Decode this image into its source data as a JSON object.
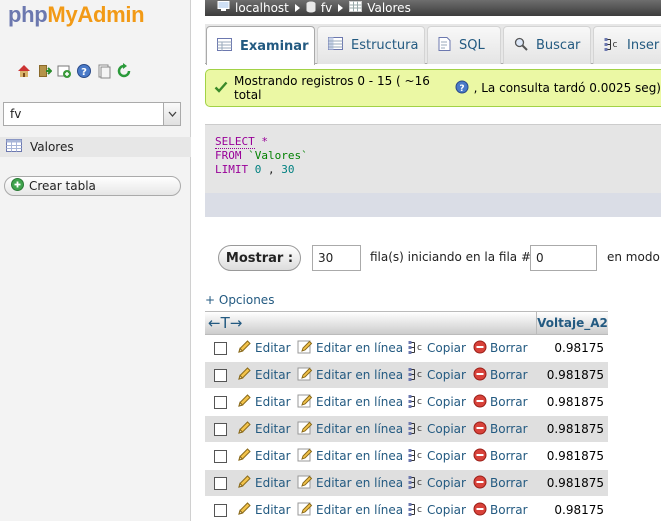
{
  "app": {
    "logo_php": "php",
    "logo_myadmin": "MyAdmin"
  },
  "sidebar": {
    "icons": [
      "home-icon",
      "exit-icon",
      "sql-window-icon",
      "help-icon",
      "documentation-icon",
      "reload-icon"
    ],
    "db_selected": "fv",
    "table_name": "Valores",
    "create_table_label": "Crear tabla"
  },
  "breadcrumb": {
    "server": "localhost",
    "database": "fv",
    "table": "Valores"
  },
  "tabs": [
    {
      "label": "Examinar",
      "active": true
    },
    {
      "label": "Estructura",
      "active": false
    },
    {
      "label": "SQL",
      "active": false
    },
    {
      "label": "Buscar",
      "active": false
    },
    {
      "label": "Inser",
      "active": false
    }
  ],
  "message": {
    "before_help": "Mostrando registros 0 - 15 ( ~16 total",
    "after_help": ", La consulta tardó 0.0025 seg)"
  },
  "sql": {
    "select_kw": "SELECT",
    "select_rest": " *",
    "from_kw": "FROM",
    "table_str": " `Valores`",
    "limit_kw": "LIMIT",
    "limit_a": " 0",
    "limit_sep": " , ",
    "limit_b": "30"
  },
  "navigation": {
    "show_button": "Mostrar :",
    "rows_value": "30",
    "start_label": "fila(s) iniciando en la fila #",
    "start_value": "0",
    "mode_label": "en modo"
  },
  "options_link": "+ Opciones",
  "table": {
    "sort_arrows": "←T→",
    "column": "Voltaje_A2",
    "actions": {
      "edit": "Editar",
      "inline": "Editar en línea",
      "copy": "Copiar",
      "delete": "Borrar"
    },
    "rows": [
      "0.98175",
      "0.981875",
      "0.981875",
      "0.981875",
      "0.981875",
      "0.981875",
      "0.98175"
    ]
  },
  "colors": {
    "link": "#235a81",
    "success_bg": "#ebf8a4",
    "logo_php": "#6c78af",
    "logo_myadmin": "#f29a16"
  }
}
